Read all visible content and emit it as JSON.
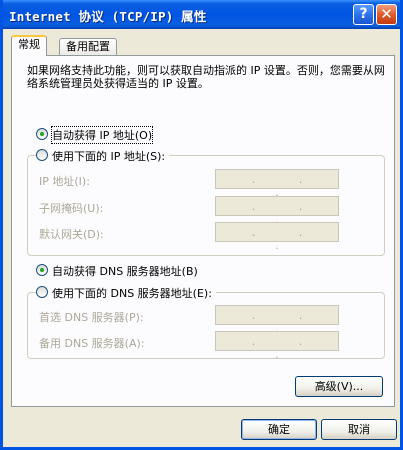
{
  "window": {
    "title": "Internet 协议 (TCP/IP) 属性",
    "help_label": "?",
    "close_label": "✕"
  },
  "tabs": [
    {
      "label": "常规",
      "active": true
    },
    {
      "label": "备用配置",
      "active": false
    }
  ],
  "description": "如果网络支持此功能，则可以获取自动指派的 IP 设置。否则，您需要从网络系统管理员处获得适当的 IP 设置。",
  "ip_mode": {
    "auto_label": "自动获得 IP 地址(O)",
    "manual_label": "使用下面的 IP 地址(S):",
    "selected": "auto"
  },
  "ip_fields": [
    {
      "label": "IP 地址(I):",
      "value": ". . ."
    },
    {
      "label": "子网掩码(U):",
      "value": ". . ."
    },
    {
      "label": "默认网关(D):",
      "value": ". . ."
    }
  ],
  "dns_mode": {
    "auto_label": "自动获得 DNS 服务器地址(B)",
    "manual_label": "使用下面的 DNS 服务器地址(E):",
    "selected": "auto"
  },
  "dns_fields": [
    {
      "label": "首选 DNS 服务器(P):",
      "value": ". . ."
    },
    {
      "label": "备用 DNS 服务器(A):",
      "value": ". . ."
    }
  ],
  "buttons": {
    "advanced": "高级(V)...",
    "ok": "确定",
    "cancel": "取消"
  },
  "colors": {
    "titlebar": "#0054E3",
    "dialog_bg": "#ECE9D8",
    "panel_bg": "#FCFCFE",
    "radio_selected": "#21A121",
    "disabled_text": "#ACA899"
  }
}
